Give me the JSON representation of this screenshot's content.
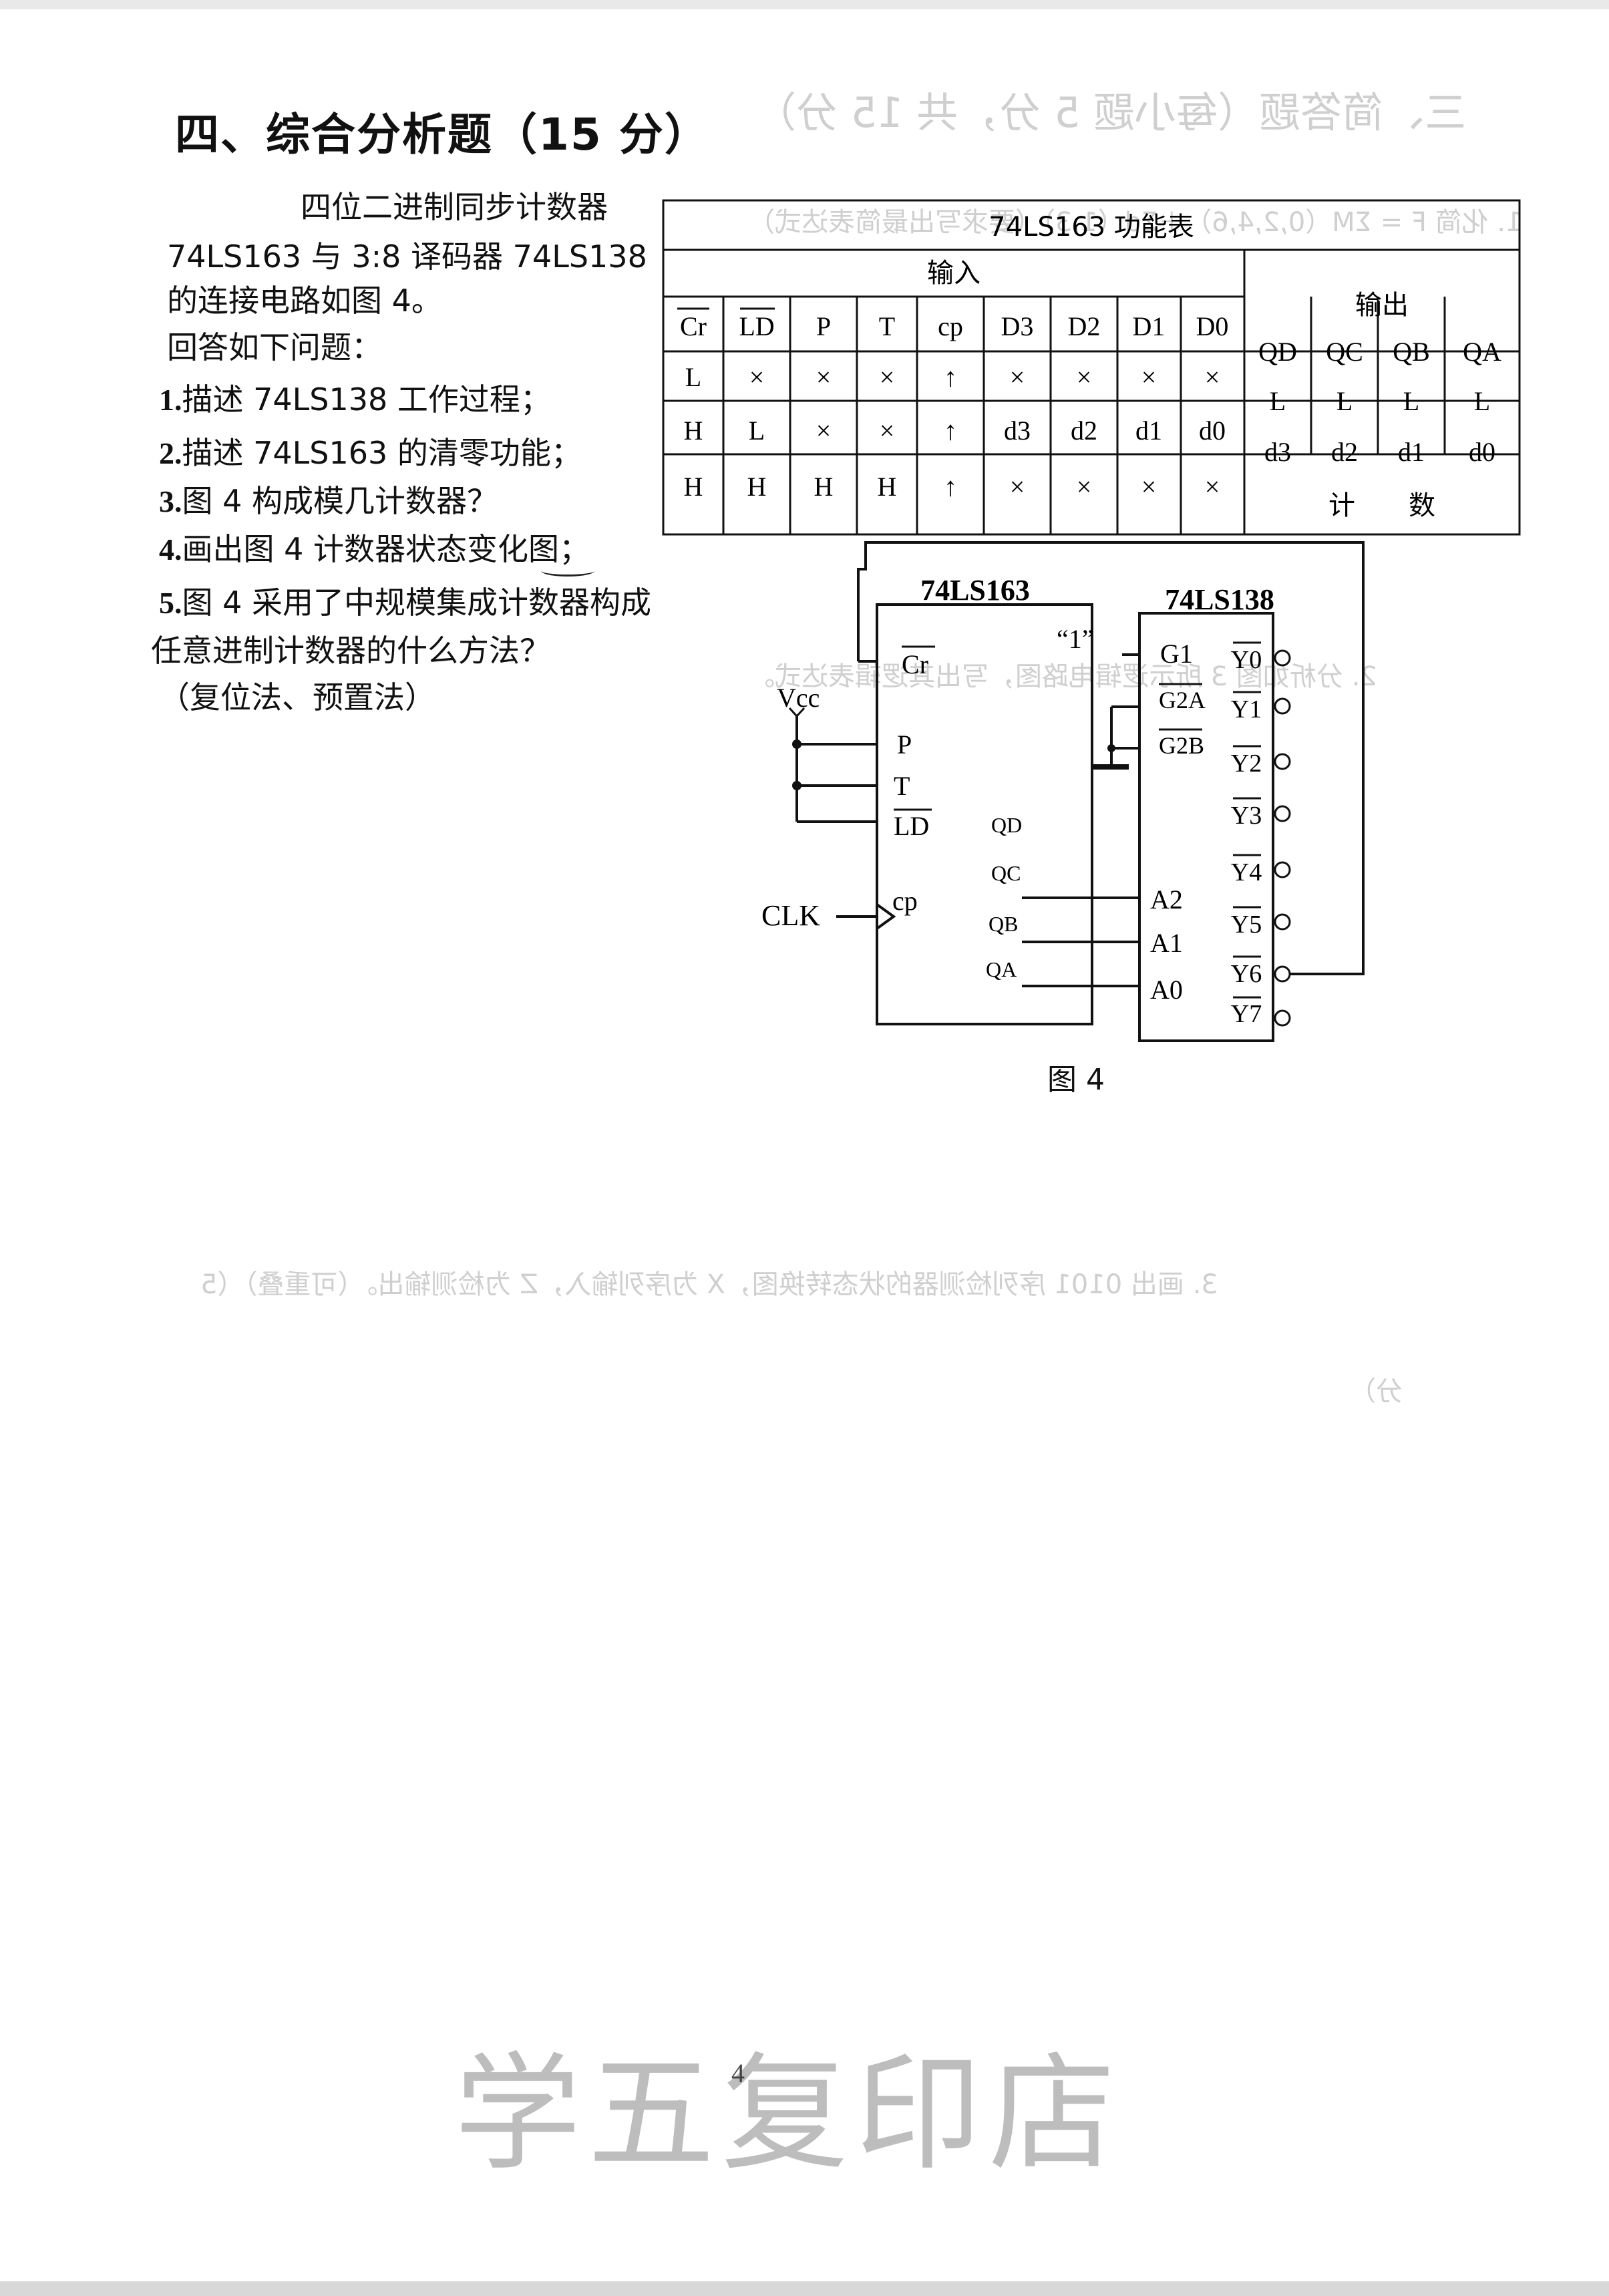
{
  "section_title": "四、综合分析题（15 分）",
  "question": {
    "intro_1": "四位二进制同步计数器",
    "intro_2": "74LS163 与 3:8 译码器 74LS138",
    "intro_3": "的连接电路如图 4。",
    "prompt": "回答如下问题：",
    "items": [
      {
        "no": "1.",
        "text": "描述 74LS138 工作过程；"
      },
      {
        "no": "2.",
        "text": "描述 74LS163 的清零功能；"
      },
      {
        "no": "3.",
        "text": "图 4 构成模几计数器？"
      },
      {
        "no": "4.",
        "text": "画出图 4 计数器状态变化图；"
      },
      {
        "no": "5.",
        "text": "图 4 采用了中规模集成计数器构成"
      }
    ],
    "item5_cont": "任意进制计数器的什么方法？",
    "answer_note": "（复位法、预置法）"
  },
  "function_table": {
    "title": "74LS163 功能表",
    "input_header": "输入",
    "output_header": "输出",
    "columns": [
      "Cr",
      "LD",
      "P",
      "T",
      "cp",
      "D3",
      "D2",
      "D1",
      "D0",
      "QD",
      "QC",
      "QB",
      "QA"
    ],
    "rows": [
      [
        "L",
        "×",
        "×",
        "×",
        "↑",
        "×",
        "×",
        "×",
        "×",
        "L",
        "L",
        "L",
        "L"
      ],
      [
        "H",
        "L",
        "×",
        "×",
        "↑",
        "d3",
        "d2",
        "d1",
        "d0",
        "d3",
        "d2",
        "d1",
        "d0"
      ],
      [
        "H",
        "H",
        "H",
        "H",
        "↑",
        "×",
        "×",
        "×",
        "×",
        "计　　数"
      ]
    ]
  },
  "circuit": {
    "chip1": "74LS163",
    "chip2": "74LS138",
    "vcc": "Vcc",
    "clk": "CLK",
    "one_label": "“1”",
    "chip1_pins_left": [
      "Cr",
      "P",
      "T",
      "LD",
      "cp"
    ],
    "chip1_pins_right": [
      "QD",
      "QC",
      "QB",
      "QA"
    ],
    "chip2_pins_left": [
      "G1",
      "G2A",
      "G2B",
      "A2",
      "A1",
      "A0"
    ],
    "chip2_pins_right": [
      "Y0",
      "Y1",
      "Y2",
      "Y3",
      "Y4",
      "Y5",
      "Y6",
      "Y7"
    ]
  },
  "figure_caption": "图 4",
  "page_number": "4",
  "stamp": "学五复印店",
  "bleed_through": {
    "heading": "三、简答题（每小题 5 分，共 15 分）",
    "q1": "1. 化简 F = ΣM（0,2,4,6）＋Σd（1,3）（要求写出最简表达式）",
    "q2": "2. 分析如图 3 所示逻辑电路图，写出其逻辑表达式。",
    "q3": "3. 画出 0101 序列检测器的状态转换图，X 为序列输入，Z 为检测输出。（可重叠）（5",
    "q3_cont": "分）"
  }
}
